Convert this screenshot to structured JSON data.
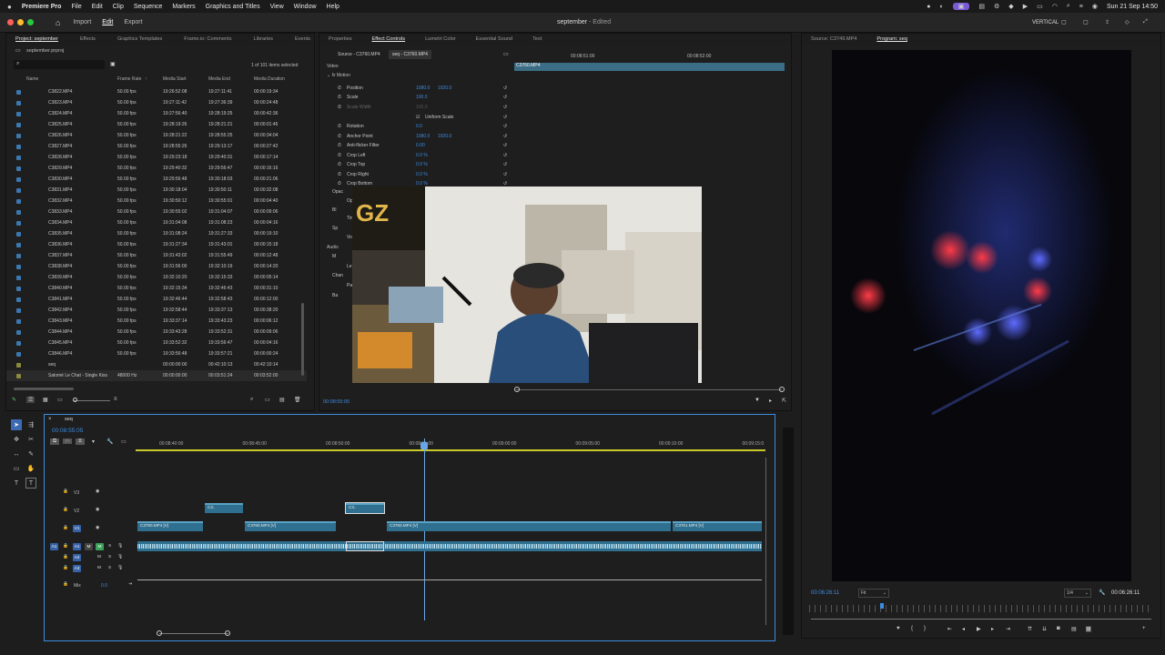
{
  "menubar": {
    "app": "Premiere Pro",
    "items": [
      "File",
      "Edit",
      "Clip",
      "Sequence",
      "Markers",
      "Graphics and Titles",
      "View",
      "Window",
      "Help"
    ],
    "datetime": "Sun 21 Sep  14:50"
  },
  "header": {
    "nav": [
      "Import",
      "Edit",
      "Export"
    ],
    "active": "Edit",
    "title": "september",
    "status": "- Edited",
    "workspace": "VERTICAL"
  },
  "project": {
    "tabs": [
      "Project: september",
      "Effects",
      "Graphics Templates",
      "Frame.io: Comments",
      "Libraries",
      "Events"
    ],
    "file": "september.prproj",
    "selection": "1 of 101 items selected",
    "columns": [
      "Name",
      "Frame Rate",
      "Media Start",
      "Media End",
      "Media Duration"
    ],
    "rows": [
      [
        "C3822.MP4",
        "50.00 fps",
        "19:26:52:08",
        "19:27:11:41",
        "00:00:19:34"
      ],
      [
        "C3823.MP4",
        "50.00 fps",
        "19:27:11:42",
        "19:27:36:39",
        "00:00:24:48"
      ],
      [
        "C3824.MP4",
        "50.00 fps",
        "19:27:56:40",
        "19:28:19:25",
        "00:00:42:36"
      ],
      [
        "C3825.MP4",
        "50.00 fps",
        "19:28:19:26",
        "19:28:21:21",
        "00:00:01:46"
      ],
      [
        "C3826.MP4",
        "50.00 fps",
        "19:28:21:22",
        "19:28:55:25",
        "00:00:34:04"
      ],
      [
        "C3827.MP4",
        "50.00 fps",
        "19:28:55:26",
        "19:29:13:17",
        "00:00:27:42"
      ],
      [
        "C3828.MP4",
        "50.00 fps",
        "19:29:23:18",
        "19:29:40:31",
        "00:00:17:14"
      ],
      [
        "C3829.MP4",
        "50.00 fps",
        "19:29:40:32",
        "19:29:56:47",
        "00:00:16:16"
      ],
      [
        "C3830.MP4",
        "50.00 fps",
        "19:29:56:48",
        "19:30:18:03",
        "00:00:21:06"
      ],
      [
        "C3831.MP4",
        "50.00 fps",
        "19:30:18:04",
        "19:30:50:11",
        "00:00:32:08"
      ],
      [
        "C3832.MP4",
        "50.00 fps",
        "19:30:50:12",
        "19:30:55:01",
        "00:00:04:40"
      ],
      [
        "C3833.MP4",
        "50.00 fps",
        "19:30:55:02",
        "19:31:04:07",
        "00:00:09:06"
      ],
      [
        "C3834.MP4",
        "50.00 fps",
        "19:31:04:08",
        "19:31:08:23",
        "00:00:04:16"
      ],
      [
        "C3835.MP4",
        "50.00 fps",
        "19:31:08:24",
        "19:31:27:33",
        "00:00:19:10"
      ],
      [
        "C3836.MP4",
        "50.00 fps",
        "19:31:27:34",
        "19:31:43:01",
        "00:00:15:18"
      ],
      [
        "C3837.MP4",
        "50.00 fps",
        "19:31:43:02",
        "19:31:55:49",
        "00:00:12:48"
      ],
      [
        "C3838.MP4",
        "50.00 fps",
        "19:31:56:00",
        "19:32:10:19",
        "00:00:14:20"
      ],
      [
        "C3839.MP4",
        "50.00 fps",
        "19:32:10:20",
        "19:32:15:33",
        "00:00:05:14"
      ],
      [
        "C3840.MP4",
        "50.00 fps",
        "19:32:15:34",
        "19:32:46:43",
        "00:00:31:10"
      ],
      [
        "C3841.MP4",
        "50.00 fps",
        "19:32:46:44",
        "19:32:58:43",
        "00:00:12:00"
      ],
      [
        "C3842.MP4",
        "50.00 fps",
        "19:32:58:44",
        "19:33:37:13",
        "00:00:38:20"
      ],
      [
        "C3843.MP4",
        "50.00 fps",
        "19:33:37:14",
        "19:33:43:23",
        "00:00:06:12"
      ],
      [
        "C3844.MP4",
        "50.00 fps",
        "19:33:43:28",
        "19:33:52:31",
        "00:00:09:06"
      ],
      [
        "C3845.MP4",
        "50.00 fps",
        "19:33:52:32",
        "19:33:56:47",
        "00:00:04:16"
      ],
      [
        "C3846.MP4",
        "50.00 fps",
        "19:33:56:48",
        "19:33:57:21",
        "00:00:00:24"
      ],
      [
        "seq",
        "",
        "00:00:00:00",
        "00:42:10:13",
        "00:42:10:14"
      ],
      [
        "Salomé Le Chat - Single Kiss",
        "48000 Hz",
        "00:00:00:00",
        "00:03:51:24",
        "00:03:52:00"
      ]
    ]
  },
  "effects": {
    "tabs": [
      "Properties",
      "Effect Controls",
      "Lumetri Color",
      "Essential Sound",
      "Text"
    ],
    "active": "Effect Controls",
    "source": "Source - C3760.MP4",
    "seq": "seq - C3760.MP4",
    "ruler": [
      "00:08:51:00",
      "00:08:52:00"
    ],
    "clipname": "C3760.MP4",
    "sections": [
      "Video",
      "Audio"
    ],
    "motion": "Motion",
    "props": [
      {
        "name": "Position",
        "v1": "1080.0",
        "v2": "1920.0"
      },
      {
        "name": "Scale",
        "v1": "100.0",
        "v2": ""
      },
      {
        "name": "Scale Width",
        "v1": "100.0",
        "v2": ""
      },
      {
        "name": "Uniform Scale",
        "v1": "",
        "v2": ""
      },
      {
        "name": "Rotation",
        "v1": "0.0",
        "v2": ""
      },
      {
        "name": "Anchor Point",
        "v1": "1080.0",
        "v2": "1920.0"
      },
      {
        "name": "Anti-flicker Filter",
        "v1": "0.00",
        "v2": ""
      },
      {
        "name": "Crop Left",
        "v1": "0.0 %",
        "v2": ""
      },
      {
        "name": "Crop Top",
        "v1": "0.0 %",
        "v2": ""
      },
      {
        "name": "Crop Right",
        "v1": "0.0 %",
        "v2": ""
      },
      {
        "name": "Crop Bottom",
        "v1": "0.0 %",
        "v2": ""
      }
    ],
    "collapsed": [
      "Opac",
      "Op",
      "Bl",
      "Time",
      "Sp",
      "Volu",
      "M",
      "Le",
      "Chan",
      "Pann",
      "Ba"
    ],
    "timecode": "00:08:55:05"
  },
  "timeline": {
    "seq": "seq",
    "timecode": "00:08:55:05",
    "ticks": [
      "00:08:40:00",
      "00:08:45:00",
      "00:08:50:00",
      "00:08:55:00",
      "00:09:00:00",
      "00:09:05:00",
      "00:09:10:00",
      "00:09:15:0"
    ],
    "tracks": [
      "V3",
      "V2",
      "V1",
      "A1",
      "A2",
      "A3",
      "Mix"
    ],
    "mixval": "0.0",
    "clips": {
      "v1a": "C3760.MP4 [V]",
      "v1b": "C3760.MP4 [V]",
      "v1c": "C3760.MP4 [V]",
      "v1d": "C3761.MP4 [V]",
      "v2a": "C3..",
      "v2b": "C3.."
    }
  },
  "program": {
    "tabs": [
      "Source: C3749.MP4",
      "Program: seq"
    ],
    "active": "Program: seq",
    "timecode_left": "00:06:26:11",
    "fit": "Fit",
    "res": "1/4",
    "timecode_right": "00:06:26:11"
  }
}
